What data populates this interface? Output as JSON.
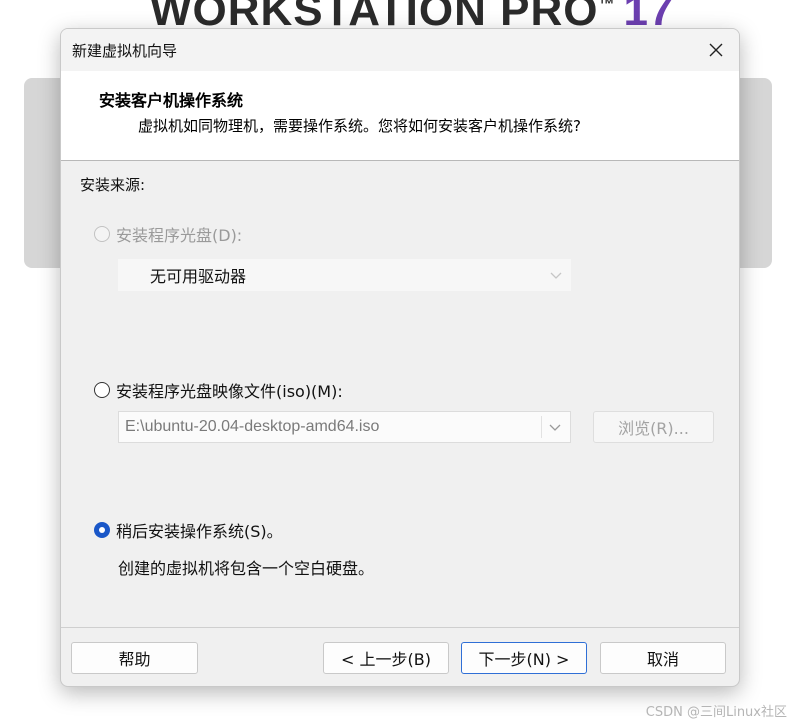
{
  "background": {
    "banner_text": "WORKSTATION PRO",
    "banner_tm": "™",
    "banner_version": "17"
  },
  "dialog": {
    "title": "新建虚拟机向导",
    "header": {
      "title": "安装客户机操作系统",
      "description": "虚拟机如同物理机，需要操作系统。您将如何安装客户机操作系统?"
    },
    "section_label": "安装来源:",
    "options": {
      "disc": {
        "label": "安装程序光盘(D):",
        "selected": false,
        "enabled": false,
        "drive_value": "无可用驱动器"
      },
      "iso": {
        "label": "安装程序光盘映像文件(iso)(M):",
        "selected": false,
        "enabled": true,
        "path_value": "E:\\ubuntu-20.04-desktop-amd64.iso",
        "browse_label": "浏览(R)..."
      },
      "later": {
        "label": "稍后安装操作系统(S)。",
        "selected": true,
        "enabled": true,
        "note": "创建的虚拟机将包含一个空白硬盘。"
      }
    },
    "buttons": {
      "help": "帮助",
      "back": "< 上一步(B)",
      "next": "下一步(N) >",
      "cancel": "取消"
    }
  },
  "watermark": "CSDN @三间Linux社区",
  "colors": {
    "accent": "#1a57c8",
    "dialog_bg": "#f0f0f0",
    "header_bg": "#ffffff",
    "disabled_text": "#9a9a9a",
    "brand_purple": "#6c3fb0"
  }
}
